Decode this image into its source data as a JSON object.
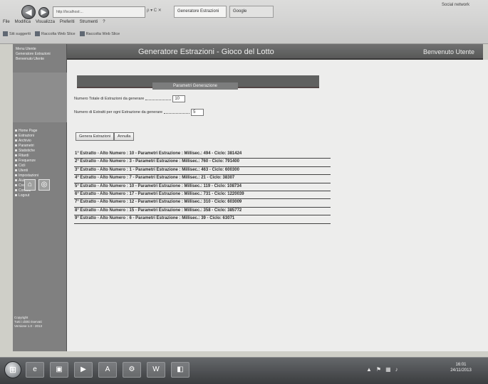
{
  "browser": {
    "address": "http://localhost:...",
    "address_tools": "ρ ▾ C ✕",
    "tabs": [
      "Generatore Estrazioni",
      "Google"
    ],
    "window_title": "Social network",
    "menu": [
      "File",
      "Modifica",
      "Visualizza",
      "Preferiti",
      "Strumenti",
      "?"
    ],
    "favorites": [
      "Siti suggeriti",
      "Raccolta Web Slice",
      "Raccolta Web Slice"
    ]
  },
  "sidebar": {
    "header_lines": [
      "Menu Utente",
      "Generatore Estrazioni",
      "Benvenuto Utente"
    ],
    "menu_items": [
      "Home Page",
      "Estrazioni",
      "Archivio",
      "Parametri",
      "Statistiche",
      "Ritardi",
      "Frequenze",
      "Cicli",
      "Utenti",
      "Impostazioni",
      "Aiuto",
      "Credits",
      "Contatti",
      "Logout"
    ],
    "footer_lines": [
      "Copyright",
      "Tutti i diritti riservati",
      "Versione 1.0 - 2013"
    ]
  },
  "header": {
    "title": "Generatore Estrazioni - Gioco del Lotto",
    "user": "Benvenuto Utente"
  },
  "form": {
    "section_title": "Parametri Generazione",
    "field1_label": "Numero Totale di Estrazioni da generare",
    "field1_value": "10",
    "field2_label": "Numero di Estratti per ogni Estrazione da generare",
    "field2_value": "5",
    "generate_label": "Genera Estrazioni",
    "reset_label": "Annulla"
  },
  "results": [
    "1° Estratto - Alto Numero : 10 - Parametri Estrazione : Millisec.: 494 - Ciclo: 381424",
    "2° Estratto - Alto Numero : 3 - Parametri Estrazione : Millisec.: 760 - Ciclo: 791400",
    "3° Estratto - Alto Numero : 1 - Parametri Estrazione : Millisec.: 463 - Ciclo: 600300",
    "4° Estratto - Alto Numero : 7 - Parametri Estrazione : Millisec.: 21 - Ciclo: 38307",
    "5° Estratto - Alto Numero : 10 - Parametri Estrazione : Millisec.: 119 - Ciclo: 108734",
    "6° Estratto - Alto Numero : 17 - Parametri Estrazione : Millisec.: 731 - Ciclo: 1220039",
    "7° Estratto - Alto Numero : 12 - Parametri Estrazione : Millisec.: 310 - Ciclo: 603009",
    "8° Estratto - Alto Numero : 15 - Parametri Estrazione : Millisec.: 358 - Ciclo: 385772",
    "9° Estratto - Alto Numero : 6 - Parametri Estrazione : Millisec.: 39 - Ciclo: 63071"
  ],
  "taskbar": {
    "apps": [
      "e",
      "▣",
      "▶",
      "A",
      "⚙",
      "W",
      "◧"
    ],
    "clock_time": "16:01",
    "clock_date": "24/11/2013"
  }
}
